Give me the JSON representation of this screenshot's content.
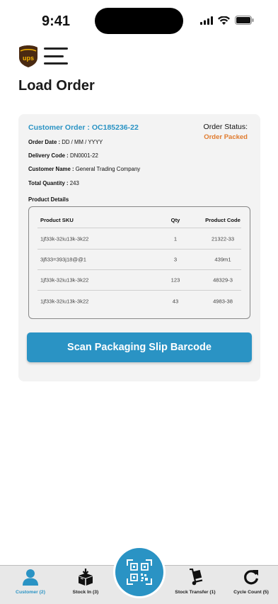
{
  "status_bar": {
    "time": "9:41"
  },
  "header": {
    "page_title": "Load Order",
    "logo_text": "UPS"
  },
  "order": {
    "customer_order": "Customer Order : OC185236-22",
    "status_label": "Order Status:",
    "status_value": "Order Packed",
    "order_date_label": "Order Date :",
    "order_date_value": "DD / MM / YYYY",
    "delivery_code_label": "Delivery Code :",
    "delivery_code_value": "DN0001-22",
    "customer_name_label": "Customer Name :",
    "customer_name_value": "General Trading Company",
    "total_quantity_label": "Total Quantity :",
    "total_quantity_value": "243",
    "product_details_label": "Product Details"
  },
  "table": {
    "headers": {
      "sku": "Product SKU",
      "qty": "Qty",
      "code": "Product Code"
    },
    "rows": [
      {
        "sku": "1jf33k-32iu13k-3k22",
        "qty": "1",
        "code": "21322-33"
      },
      {
        "sku": "3jfi33=393j18@@1",
        "qty": "3",
        "code": "439m1"
      },
      {
        "sku": "1jf33k-32iu13k-3k22",
        "qty": "123",
        "code": "48329-3"
      },
      {
        "sku": "1jf33k-32iu13k-3k22",
        "qty": "43",
        "code": "4983-38"
      }
    ]
  },
  "actions": {
    "scan_label": "Scan Packaging Slip Barcode"
  },
  "bottom_nav": {
    "items": [
      {
        "label": "Customer (2)",
        "icon": "person-icon",
        "active": true
      },
      {
        "label": "Stock In (3)",
        "icon": "box-in-icon",
        "active": false
      },
      {
        "label": "Stock Transfer (1)",
        "icon": "hand-truck-icon",
        "active": false
      },
      {
        "label": "Cycle Count (5)",
        "icon": "refresh-icon",
        "active": false
      }
    ],
    "center_icon": "qr-scan-icon"
  },
  "colors": {
    "accent": "#2a93c4",
    "status": "#e07b2e",
    "ups_brown": "#4a2a12",
    "ups_gold": "#f5b400"
  }
}
